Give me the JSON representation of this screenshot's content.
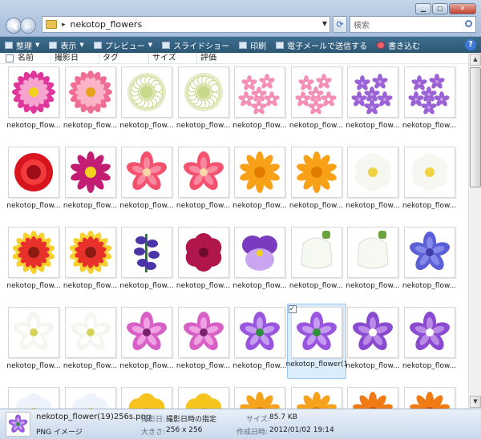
{
  "address": {
    "path": "nekotop_flowers"
  },
  "search": {
    "placeholder": "検索"
  },
  "toolbar": {
    "organize": "整理",
    "views": "表示",
    "preview": "プレビュー",
    "slideshow": "スライドショー",
    "print": "印刷",
    "email": "電子メールで送信する",
    "burn": "書き込む"
  },
  "columns": {
    "name": "名前",
    "date_taken": "撮影日",
    "tags": "タグ",
    "size": "サイズ",
    "rating": "評価"
  },
  "files": [
    {
      "label": "nekotop_flow...",
      "kind": "zinnia",
      "c1": "#e0359a",
      "c2": "#f5a3cf",
      "cc": "#f2d21b"
    },
    {
      "label": "nekotop_flow...",
      "kind": "zinnia",
      "c1": "#f06e95",
      "c2": "#fbb4c7",
      "cc": "#e6a21a"
    },
    {
      "label": "nekotop_flow...",
      "kind": "ball",
      "c1": "#e3ecc6",
      "c2": "#ffffff",
      "cc": "#c9d98c"
    },
    {
      "label": "nekotop_flow...",
      "kind": "ball",
      "c1": "#e3ecc6",
      "c2": "#ffffff",
      "cc": "#c9d98c"
    },
    {
      "label": "nekotop_flow...",
      "kind": "cluster",
      "c1": "#f48fb8",
      "c2": "#ffffff",
      "cc": "#e54f88"
    },
    {
      "label": "nekotop_flow...",
      "kind": "cluster",
      "c1": "#f48fb8",
      "c2": "#ffffff",
      "cc": "#e54f88"
    },
    {
      "label": "nekotop_flow...",
      "kind": "cluster",
      "c1": "#9b62d6",
      "c2": "#c59be9",
      "cc": "#ffffff"
    },
    {
      "label": "nekotop_flow...",
      "kind": "cluster",
      "c1": "#9b62d6",
      "c2": "#c59be9",
      "cc": "#ffffff"
    },
    {
      "label": "nekotop_flow...",
      "kind": "rose",
      "c1": "#d8141f",
      "c2": "#f23b3b",
      "cc": "#9e0c15"
    },
    {
      "label": "nekotop_flow...",
      "kind": "daisy",
      "c1": "#c21d72",
      "c2": "#e54a97",
      "cc": "#f3d31e"
    },
    {
      "label": "nekotop_flow...",
      "kind": "star5",
      "c1": "#f4516e",
      "c2": "#f88aa0",
      "cc": "#f6d9a5"
    },
    {
      "label": "nekotop_flow...",
      "kind": "star5",
      "c1": "#f4516e",
      "c2": "#f88aa0",
      "cc": "#f6d9a5"
    },
    {
      "label": "nekotop_flow...",
      "kind": "daisy",
      "c1": "#f8a017",
      "c2": "#fbc14a",
      "cc": "#e27c00"
    },
    {
      "label": "nekotop_flow...",
      "kind": "daisy",
      "c1": "#f8a017",
      "c2": "#fbc14a",
      "cc": "#e27c00"
    },
    {
      "label": "nekotop_flow...",
      "kind": "round",
      "c1": "#f7f7f2",
      "c2": "#ffffff",
      "cc": "#efd343"
    },
    {
      "label": "nekotop_flow...",
      "kind": "round",
      "c1": "#f7f7f2",
      "c2": "#ffffff",
      "cc": "#efd343"
    },
    {
      "label": "nekotop_flow...",
      "kind": "gaillardia",
      "c1": "#e8312b",
      "c2": "#f6d02d",
      "cc": "#8c1c12"
    },
    {
      "label": "nekotop_flow...",
      "kind": "gaillardia",
      "c1": "#e8312b",
      "c2": "#f6d02d",
      "cc": "#8c1c12"
    },
    {
      "label": "nekotop_flow...",
      "kind": "spike",
      "c1": "#4a34a8",
      "c2": "#7a64d4",
      "cc": "#2d7a2e"
    },
    {
      "label": "nekotop_flow...",
      "kind": "round",
      "c1": "#b0154c",
      "c2": "#d12a64",
      "cc": "#6e0a2b"
    },
    {
      "label": "nekotop_flow...",
      "kind": "pansy",
      "c1": "#7a3bc0",
      "c2": "#c9a6ef",
      "cc": "#f2d21b"
    },
    {
      "label": "nekotop_flow...",
      "kind": "bell",
      "c1": "#f6f8f2",
      "c2": "#ffffff",
      "cc": "#6aa33c"
    },
    {
      "label": "nekotop_flow...",
      "kind": "bell",
      "c1": "#f6f8f2",
      "c2": "#ffffff",
      "cc": "#6aa33c"
    },
    {
      "label": "nekotop_flow...",
      "kind": "star5",
      "c1": "#5b5fd6",
      "c2": "#8488e8",
      "cc": "#3e3ea8"
    },
    {
      "label": "nekotop_flow...",
      "kind": "star5",
      "c1": "#f4f6f0",
      "c2": "#ffffff",
      "cc": "#d6d35a"
    },
    {
      "label": "nekotop_flow...",
      "kind": "star5",
      "c1": "#f4f6f0",
      "c2": "#ffffff",
      "cc": "#d6d35a"
    },
    {
      "label": "nekotop_flow...",
      "kind": "star5",
      "c1": "#d85fc5",
      "c2": "#eea2e2",
      "cc": "#7a1e6e"
    },
    {
      "label": "nekotop_flow...",
      "kind": "star5",
      "c1": "#d85fc5",
      "c2": "#eea2e2",
      "cc": "#7a1e6e"
    },
    {
      "label": "nekotop_flow...",
      "kind": "star5",
      "c1": "#9a55e0",
      "c2": "#c59cf0",
      "cc": "#2f8e3a"
    },
    {
      "label": "nekotop_flower(19)256s.png",
      "kind": "star5",
      "c1": "#9a55e0",
      "c2": "#c59cf0",
      "cc": "#2f8e3a",
      "selected": true
    },
    {
      "label": "nekotop_flow...",
      "kind": "star5",
      "c1": "#8b4bd1",
      "c2": "#b98ae6",
      "cc": "#ffffff"
    },
    {
      "label": "nekotop_flow...",
      "kind": "star5",
      "c1": "#8b4bd1",
      "c2": "#b98ae6",
      "cc": "#ffffff"
    },
    {
      "label": "",
      "kind": "round",
      "c1": "#eef3fb",
      "c2": "#ffffff",
      "cc": "#efc43a"
    },
    {
      "label": "",
      "kind": "round",
      "c1": "#eef3fb",
      "c2": "#ffffff",
      "cc": "#efc43a"
    },
    {
      "label": "",
      "kind": "round",
      "c1": "#f6c41c",
      "c2": "#fad74b",
      "cc": "#e7a008"
    },
    {
      "label": "",
      "kind": "round",
      "c1": "#f6c41c",
      "c2": "#fad74b",
      "cc": "#e7a008"
    },
    {
      "label": "",
      "kind": "daisy",
      "c1": "#f6a21c",
      "c2": "#f9c14a",
      "cc": "#e27c00"
    },
    {
      "label": "",
      "kind": "daisy",
      "c1": "#f6a21c",
      "c2": "#f9c14a",
      "cc": "#e27c00"
    },
    {
      "label": "",
      "kind": "daisy",
      "c1": "#f07a14",
      "c2": "#f7a040",
      "cc": "#c4520a"
    },
    {
      "label": "",
      "kind": "daisy",
      "c1": "#f07a14",
      "c2": "#f7a040",
      "cc": "#c4520a"
    }
  ],
  "details": {
    "name": "nekotop_flower(19)256s.png",
    "type": "PNG イメージ",
    "date_taken_label": "撮影日:",
    "date_taken_value": "撮影日時の指定",
    "dimensions_label": "大きさ:",
    "dimensions_value": "256 x 256",
    "size_label": "サイズ:",
    "size_value": "85.7 KB",
    "created_label": "作成日時:",
    "created_value": "2012/01/02 19:14"
  }
}
